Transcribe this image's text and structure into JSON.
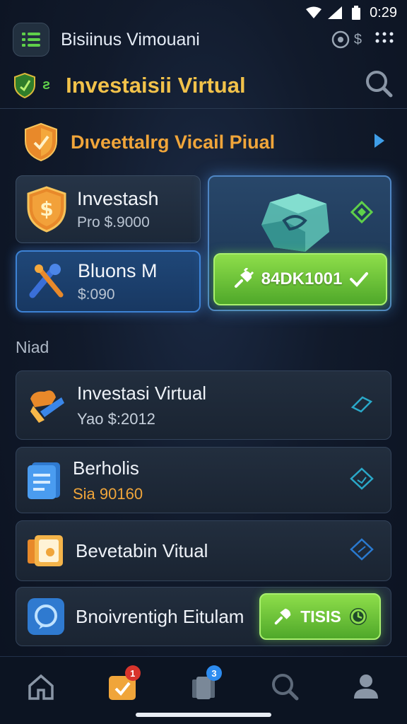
{
  "status_bar": {
    "time": "0:29"
  },
  "header": {
    "app_title": "Bisiinus Vimouani",
    "coin_label": "$"
  },
  "title_bar": {
    "badge_text": "ƨ",
    "page_title": "Investaisii Virtual"
  },
  "feature": {
    "label": "Dıveettalrg  Vicail Piual"
  },
  "card_invest": {
    "title": "Investash",
    "subtitle": "Pro $.9000"
  },
  "card_bonus": {
    "title": "Bluons M",
    "subtitle": "$:090"
  },
  "promo": {
    "button_label": "84DK1001"
  },
  "section": {
    "label": "Niad"
  },
  "list": [
    {
      "title": "Investasi Virtual",
      "subtitle": "Yao $:2012",
      "subtitle_color": "#c6d0dc"
    },
    {
      "title": "Berholis",
      "subtitle": "Sia 90160",
      "subtitle_color": "#f0a53a"
    },
    {
      "title": "Bevetabin Vitual"
    },
    {
      "title": "Bnoivrentigh Eitulam",
      "button_label": "TISIS"
    }
  ],
  "bottom_nav": {
    "items": [
      "home-icon",
      "tasks-icon",
      "wallet-icon",
      "search-icon",
      "profile-icon"
    ],
    "tasks_badge": "1",
    "wallet_badge": "3"
  },
  "colors": {
    "accent_gold": "#f2c24a",
    "accent_orange": "#f0a53a",
    "accent_green": "#5fd04a",
    "accent_blue": "#3d82d4"
  }
}
